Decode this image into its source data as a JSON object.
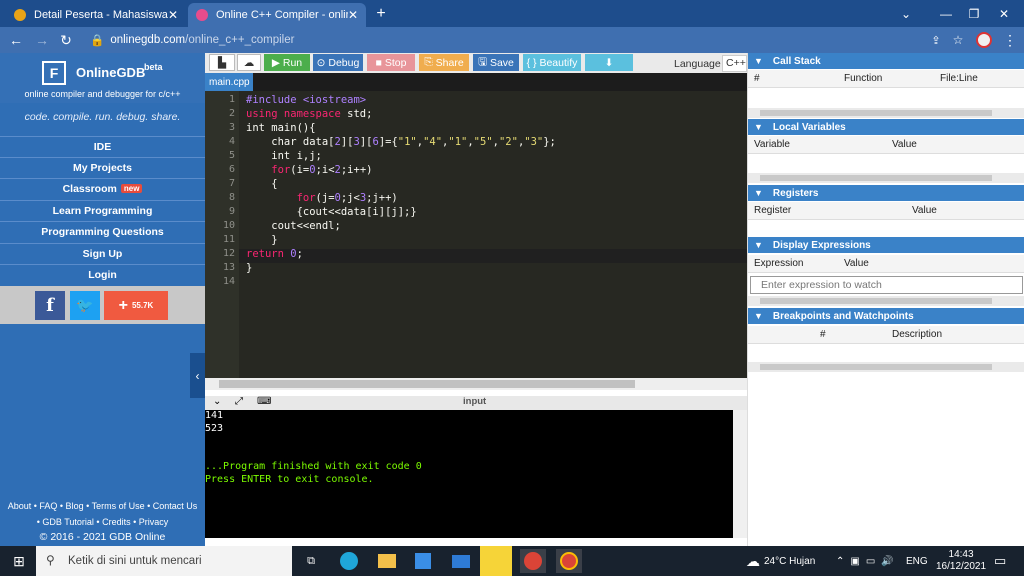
{
  "browser": {
    "tabs": [
      {
        "title": "Detail Peserta - Mahasiswa",
        "favicon_color": "#e8a317"
      },
      {
        "title": "Online C++ Compiler - online ed",
        "favicon_color": "#e74c8c"
      }
    ],
    "url_host": "onlinegdb.com",
    "url_path": "/online_c++_compiler"
  },
  "sidebar": {
    "logo_mark": "F",
    "logo_name": "OnlineGDB",
    "logo_beta": "beta",
    "logo_sub": "online compiler and debugger for c/c++",
    "tagline": "code. compile. run. debug. share.",
    "nav": [
      {
        "label": "IDE"
      },
      {
        "label": "My Projects"
      },
      {
        "label": "Classroom",
        "badge": "new"
      },
      {
        "label": "Learn Programming"
      },
      {
        "label": "Programming Questions"
      },
      {
        "label": "Sign Up"
      },
      {
        "label": "Login"
      }
    ],
    "social_count": "55.7K",
    "footer_links": "About • FAQ • Blog • Terms of Use • Contact Us",
    "footer_links2": "• GDB Tutorial • Credits • Privacy",
    "copyright": "© 2016 - 2021 GDB Online"
  },
  "toolbar": {
    "run": "Run",
    "debug": "Debug",
    "stop": "Stop",
    "share": "Share",
    "save": "Save",
    "beautify": "{ } Beautify",
    "language_label": "Language",
    "language_value": "C++"
  },
  "editor": {
    "file_tab": "main.cpp",
    "line_numbers": [
      "1",
      "2",
      "3",
      "4",
      "5",
      "6",
      "7",
      "8",
      "9",
      "10",
      "11",
      "12",
      "13",
      "14"
    ]
  },
  "console": {
    "tab_label": "input",
    "lines": [
      "141",
      "523",
      "",
      "",
      "...Program finished with exit code 0",
      "Press ENTER to exit console."
    ]
  },
  "panels": {
    "call_stack": {
      "title": "Call Stack",
      "cols": [
        "#",
        "Function",
        "File:Line"
      ]
    },
    "local_vars": {
      "title": "Local Variables",
      "cols": [
        "Variable",
        "Value"
      ]
    },
    "registers": {
      "title": "Registers",
      "cols": [
        "Register",
        "Value"
      ]
    },
    "display_expr": {
      "title": "Display Expressions",
      "cols": [
        "Expression",
        "Value"
      ],
      "placeholder": "Enter expression to watch"
    },
    "breakpoints": {
      "title": "Breakpoints and Watchpoints",
      "cols": [
        "#",
        "Description"
      ]
    }
  },
  "taskbar": {
    "search_placeholder": "Ketik di sini untuk mencari",
    "weather": "24°C Hujan",
    "lang": "ENG",
    "time": "14:43",
    "date": "16/12/2021"
  }
}
